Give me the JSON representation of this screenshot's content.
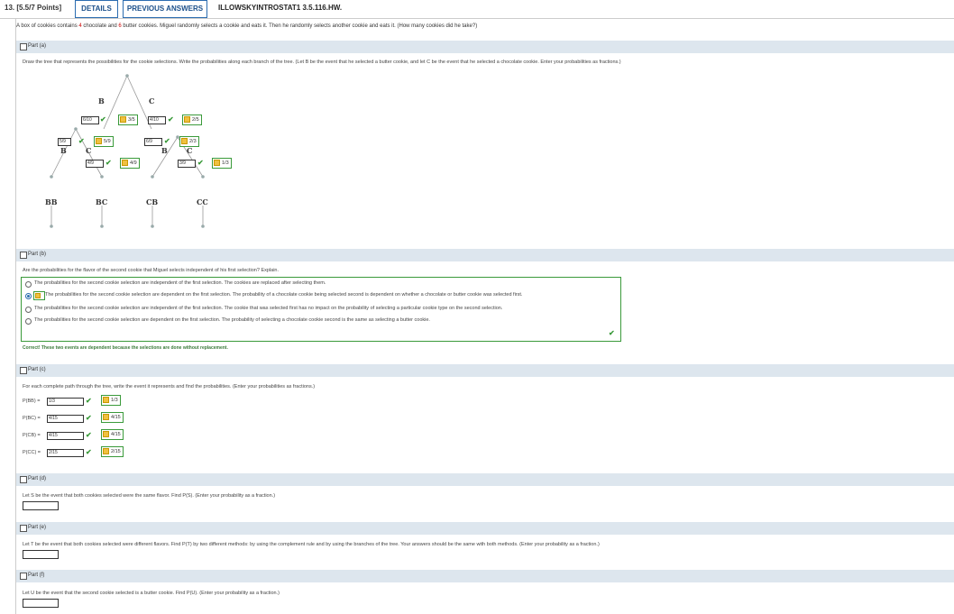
{
  "header": {
    "question": "13. [5.5/7 Points]",
    "details": "DETAILS",
    "previous": "PREVIOUS ANSWERS",
    "code": "ILLOWSKYINTROSTAT1 3.5.116.HW."
  },
  "question": {
    "pre": "A box of cookies contains ",
    "n_choc": "4",
    "mid": " chocolate and ",
    "n_butter": "6",
    "post": " butter cookies. Miguel randomly selects a cookie and eats it. Then he randomly selects another cookie and eats it. (How many cookies did he take?)"
  },
  "part_a": {
    "label": "Part (a)",
    "instructions": "Draw the tree that represents the possibilities for the cookie selections. Write the probabilities along each branch of the tree. (Let B be the event that he selected a butter cookie, and let C be the event that he selected a chocolate cookie. Enter your probabilities as fractions.)",
    "tree": {
      "top_b": "B",
      "top_c": "C",
      "ans1": "6/10",
      "key1": "3/5",
      "ans2": "4/10",
      "key2": "2/5",
      "ans3": "5/9",
      "key3": "5/9",
      "ans4": "6/9",
      "key4": "2/3",
      "ans5": "4/9",
      "key5": "4/9",
      "ans6": "3/9",
      "key6": "1/3",
      "mid_b1": "B",
      "mid_c1": "C",
      "mid_b2": "B",
      "mid_c2": "C",
      "leaves": [
        "BB",
        "BC",
        "CB",
        "CC"
      ]
    }
  },
  "part_b": {
    "label": "Part (b)",
    "question": "Are the probabilities for the flavor of the second cookie that Miguel selects independent of his first selection? Explain.",
    "options": [
      "The probabilities for the second cookie selection are independent of the first selection. The cookies are replaced after selecting them.",
      "The probabilities for the second cookie selection are dependent on the first selection. The probability of a chocolate cookie being selected second is dependent on whether a chocolate or butter cookie was selected first.",
      "The probabilities for the second cookie selection are independent of the first selection. The cookie that was selected first has no impact on the probability of selecting a particular cookie type on the second selection.",
      "The probabilities for the second cookie selection are dependent on the first selection. The probability of selecting a chocolate cookie second is the same as selecting a butter cookie."
    ],
    "feedback": "Correct! These two events are dependent because the selections are done without replacement."
  },
  "part_c": {
    "label": "Part (c)",
    "instructions": "For each complete path through the tree, write the event it represents and find the probabilities. (Enter your probabilities as fractions.)",
    "rows": [
      {
        "label": "P(BB) =",
        "answer": "1/3",
        "key": "1/3"
      },
      {
        "label": "P(BC) =",
        "answer": "4/15",
        "key": "4/15"
      },
      {
        "label": "P(CB) =",
        "answer": "4/15",
        "key": "4/15"
      },
      {
        "label": "P(CC) =",
        "answer": "2/15",
        "key": "2/15"
      }
    ]
  },
  "part_d": {
    "label": "Part (d)",
    "text": "Let S be the event that both cookies selected were the same flavor. Find P(S). (Enter your probability as a fraction.)"
  },
  "part_e": {
    "label": "Part (e)",
    "text": "Let T be the event that both cookies selected were different flavors. Find P(T) by two different methods: by using the complement rule and by using the branches of the tree. Your answers should be the same with both methods. (Enter your probability as a fraction.)"
  },
  "part_f": {
    "label": "Part (f)",
    "text": "Let U be the event that the second cookie selected is a butter cookie. Find P(U). (Enter your probability as a fraction.)"
  },
  "colors": {
    "accent": "#2b6cb0",
    "correct": "#3a9a3a",
    "bar": "#dde6ee",
    "highlight": "#cc0000"
  }
}
